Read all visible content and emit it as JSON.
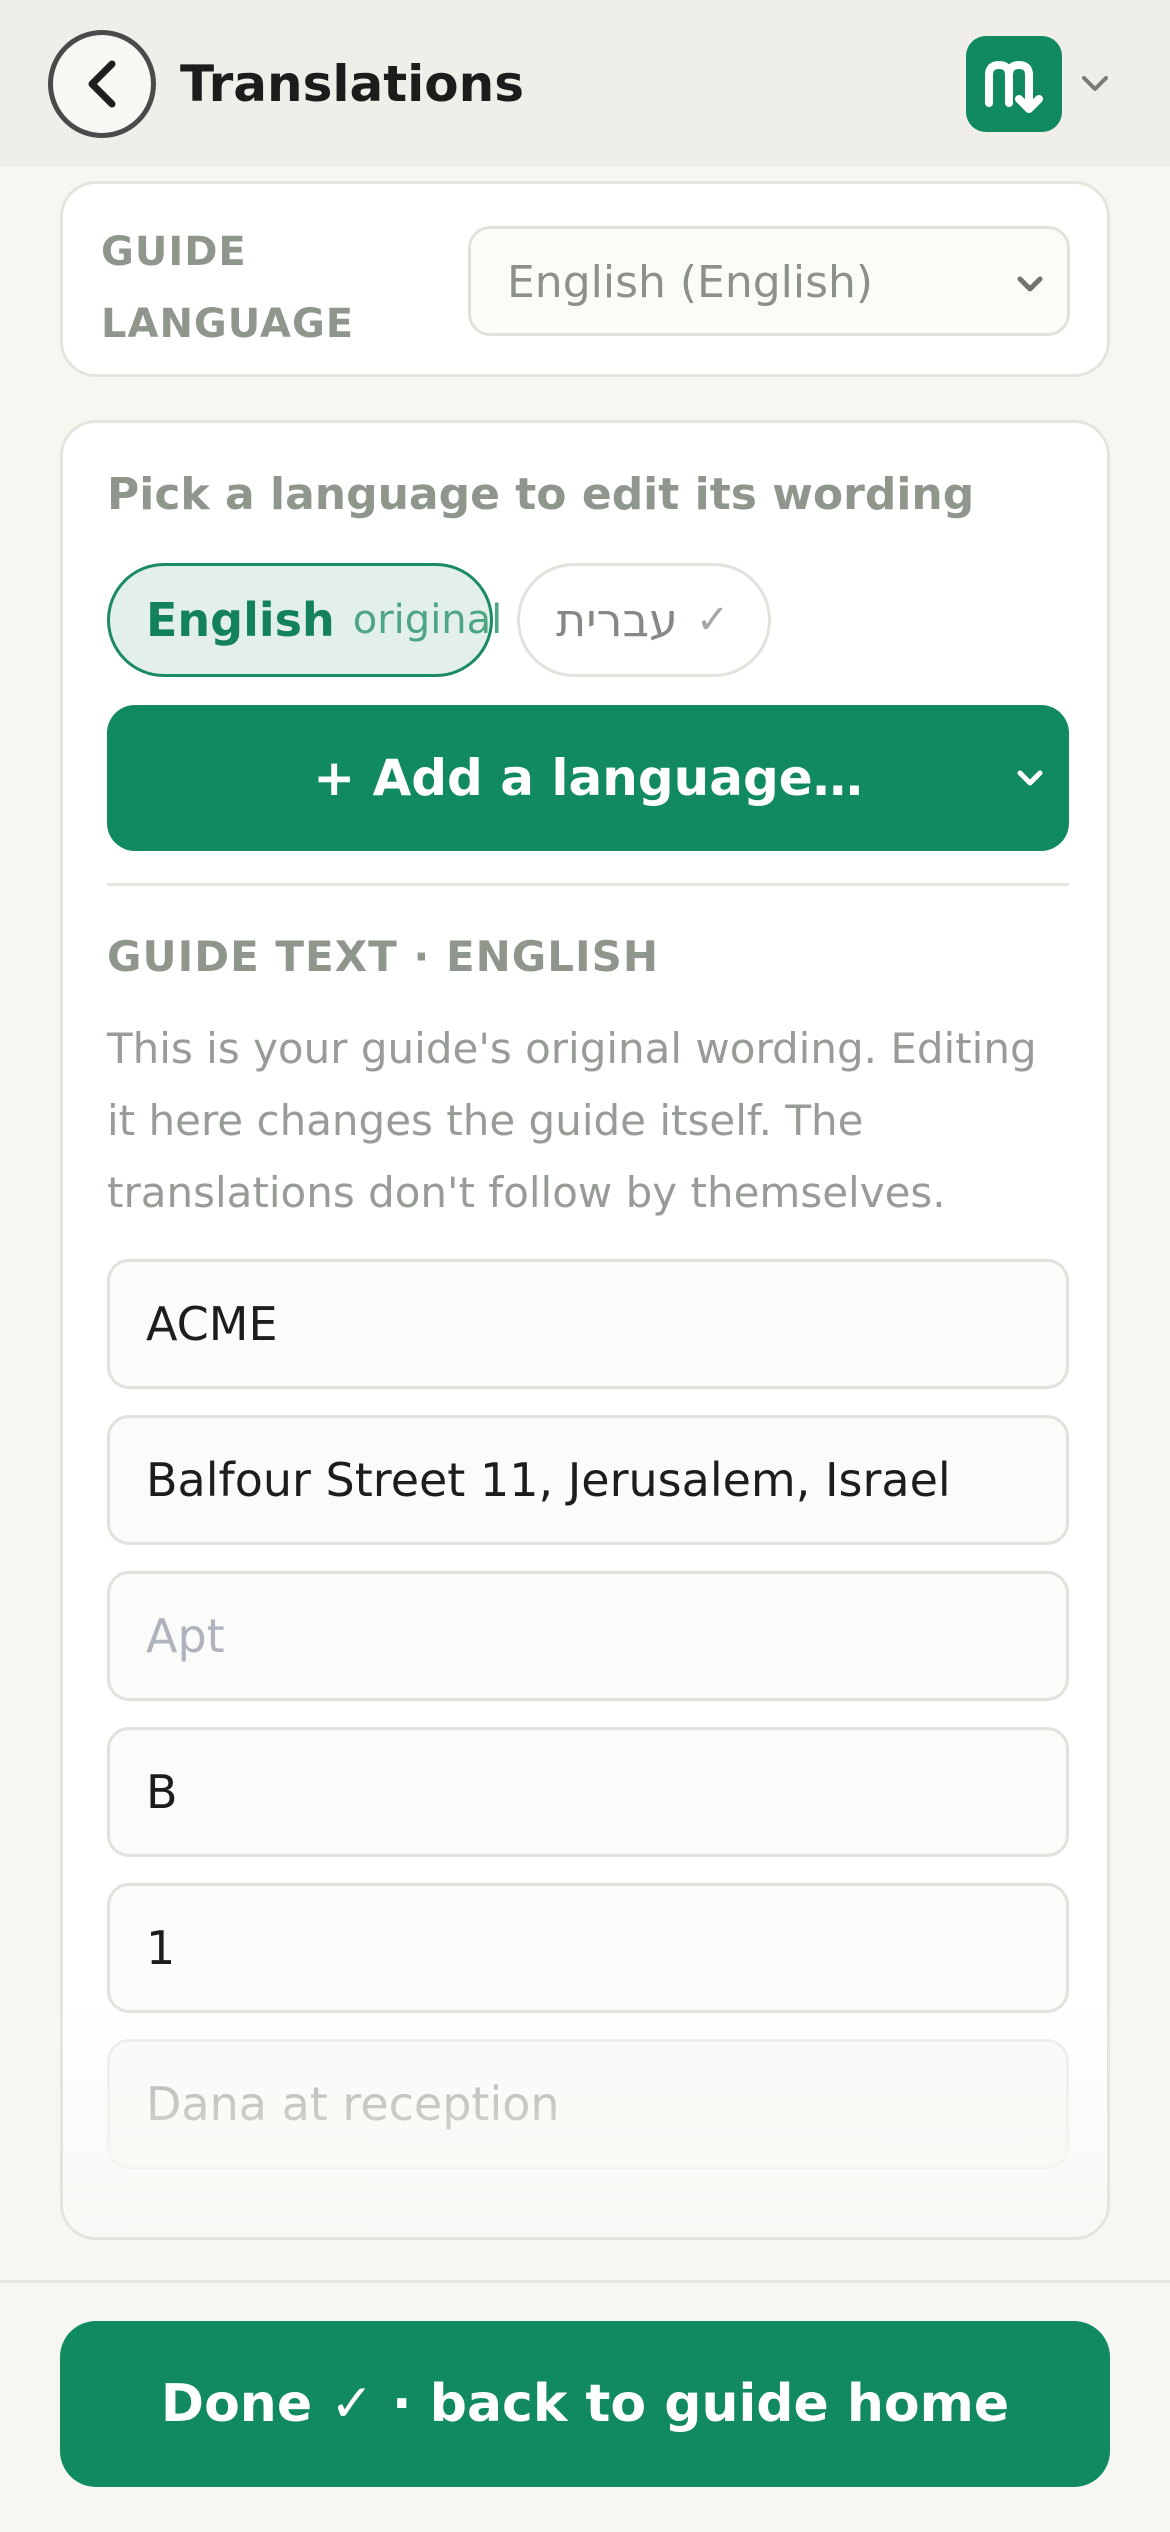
{
  "header": {
    "title": "Translations",
    "back_icon": "chevron-left-icon",
    "logo_icon": "m-arrow-logo",
    "brand_color": "#118a62"
  },
  "guide_language": {
    "label": "GUIDE LANGUAGE",
    "selected": "English (English)"
  },
  "editor": {
    "pick_label": "Pick a language to edit its wording",
    "languages": [
      {
        "name": "English",
        "tag": "original",
        "selected": true
      },
      {
        "name": "עברית",
        "tag": "✓",
        "selected": false
      }
    ],
    "add_language_label": "+ Add a language…",
    "section_label": "GUIDE TEXT · ENGLISH",
    "help_text": "This is your guide's original wording. Editing it here changes the guide itself. The translations don't follow by themselves.",
    "fields": [
      {
        "value": "ACME",
        "placeholder": ""
      },
      {
        "value": "Balfour Street 11, Jerusalem, Israel",
        "placeholder": ""
      },
      {
        "value": "",
        "placeholder": "Apt"
      },
      {
        "value": "B",
        "placeholder": ""
      },
      {
        "value": "1",
        "placeholder": ""
      },
      {
        "value": "Dana at reception",
        "placeholder": ""
      }
    ]
  },
  "footer": {
    "done_label": "Done ✓ · back to guide home"
  }
}
